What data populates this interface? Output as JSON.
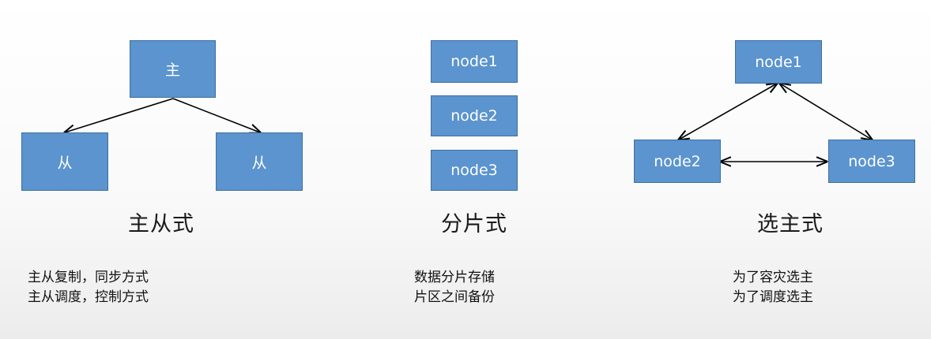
{
  "master_slave": {
    "master": "主",
    "slave_left": "从",
    "slave_right": "从",
    "title": "主从式",
    "desc": [
      "主从复制，同步方式",
      "主从调度，控制方式"
    ]
  },
  "sharding": {
    "nodes": [
      "node1",
      "node2",
      "node3"
    ],
    "title": "分片式",
    "desc": [
      "数据分片存储",
      "片区之间备份"
    ]
  },
  "election": {
    "node1": "node1",
    "node2": "node2",
    "node3": "node3",
    "title": "选主式",
    "desc": [
      "为了容灾选主",
      "为了调度选主"
    ]
  },
  "colors": {
    "node_fill": "#5b94ce",
    "node_border": "#3f6f9f",
    "arrow": "#000000"
  }
}
